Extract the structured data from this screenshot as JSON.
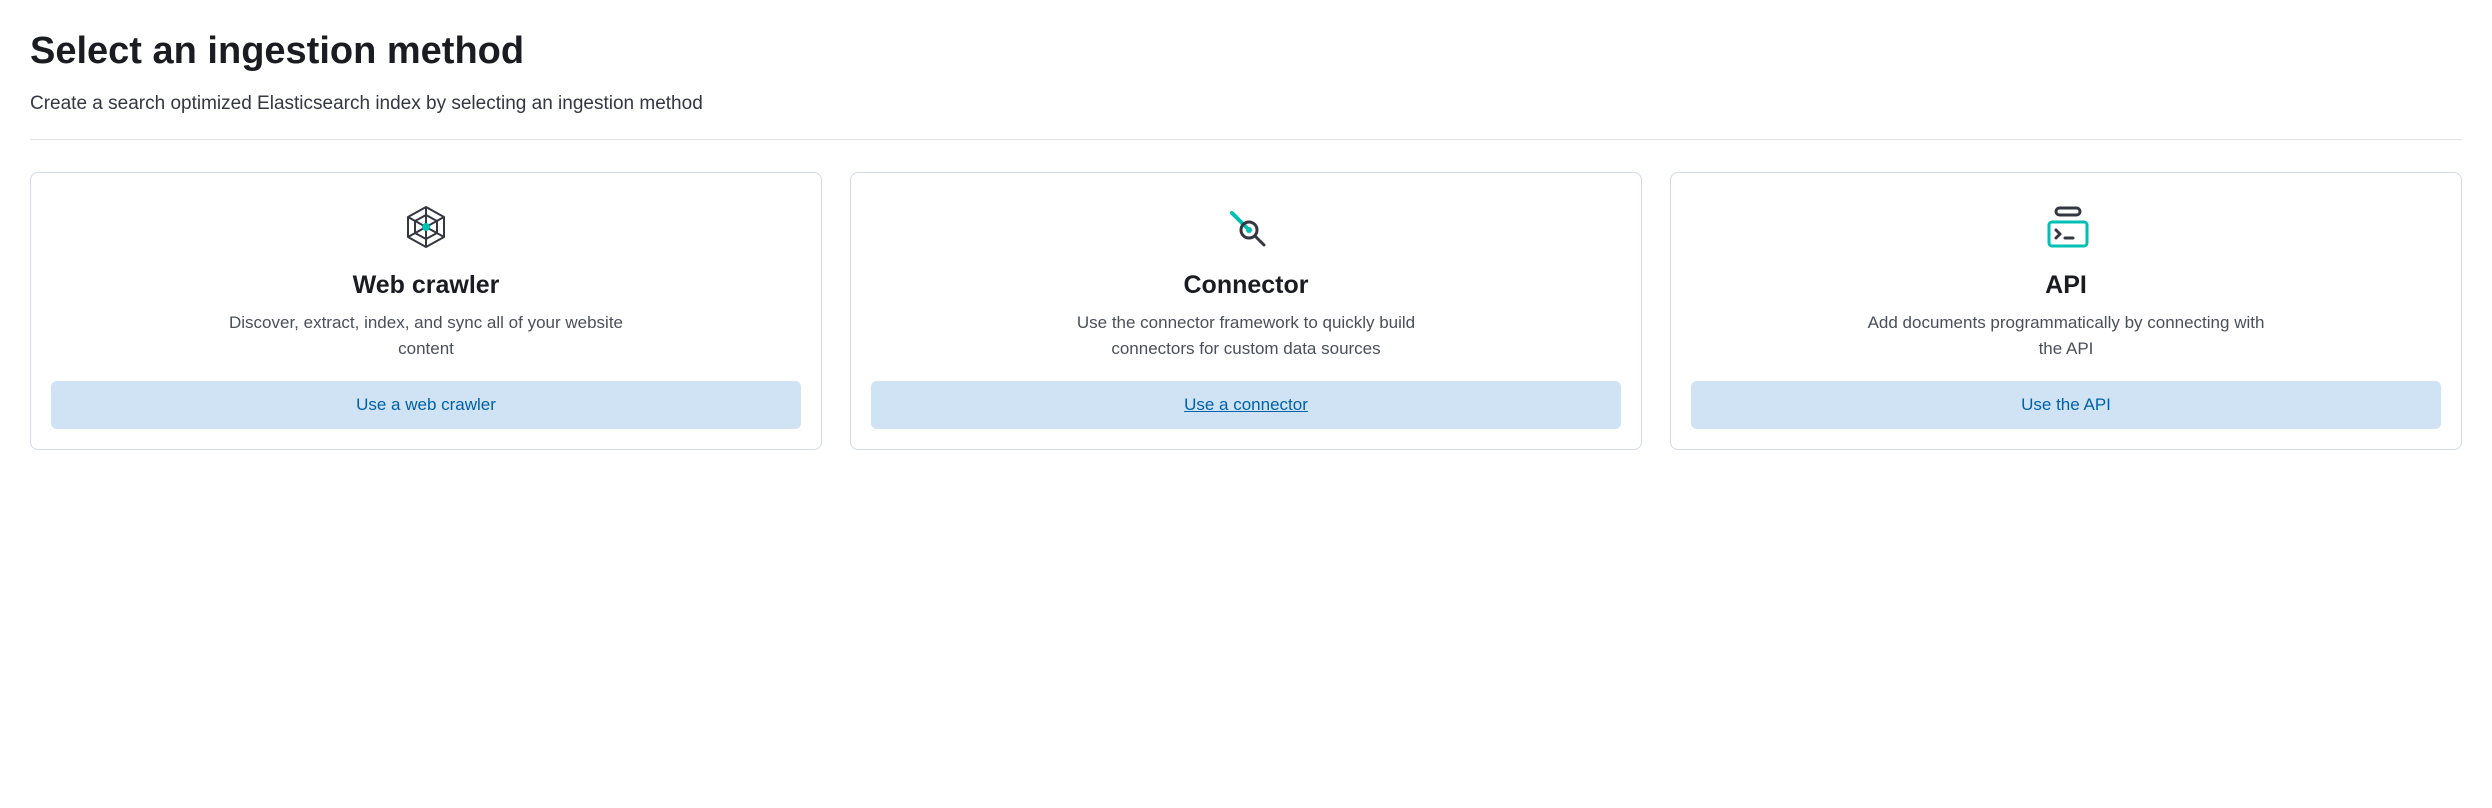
{
  "header": {
    "title": "Select an ingestion method",
    "subtitle": "Create a search optimized Elasticsearch index by selecting an ingestion method"
  },
  "cards": [
    {
      "icon": "spider-web-icon",
      "title": "Web crawler",
      "description": "Discover, extract, index, and sync all of your website content",
      "button_label": "Use a web crawler"
    },
    {
      "icon": "connector-icon",
      "title": "Connector",
      "description": "Use the connector framework to quickly build connectors for custom data sources",
      "button_label": "Use a connector"
    },
    {
      "icon": "console-icon",
      "title": "API",
      "description": "Add documents programmatically by connecting with the API",
      "button_label": "Use the API"
    }
  ]
}
